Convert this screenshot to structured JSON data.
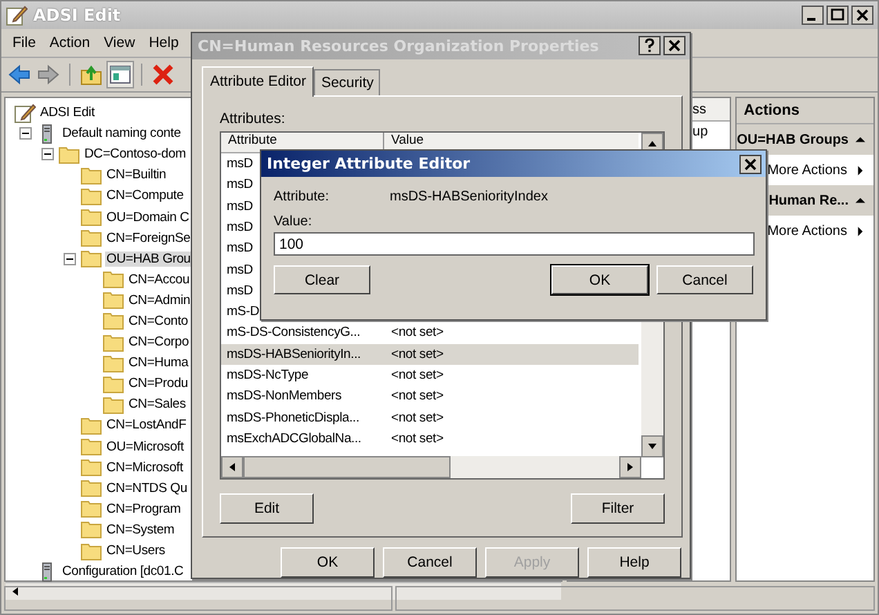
{
  "window": {
    "title": "ADSI Edit"
  },
  "menu": [
    "File",
    "Action",
    "View",
    "Help"
  ],
  "tree": [
    {
      "label": "ADSI Edit",
      "kind": "app",
      "selected": false,
      "children": [
        {
          "label": "Default naming conte",
          "kind": "server",
          "expanded": true,
          "selected": false,
          "children": [
            {
              "label": "DC=Contoso-dom",
              "kind": "folder",
              "expanded": true,
              "selected": false,
              "children": [
                {
                  "label": "CN=Builtin",
                  "kind": "folder",
                  "selected": false
                },
                {
                  "label": "CN=Compute",
                  "kind": "folder",
                  "selected": false
                },
                {
                  "label": "OU=Domain C",
                  "kind": "folder",
                  "selected": false
                },
                {
                  "label": "CN=ForeignSe",
                  "kind": "folder",
                  "selected": false
                },
                {
                  "label": "OU=HAB Grou",
                  "kind": "folder",
                  "expanded": true,
                  "selected": true,
                  "children": [
                    {
                      "label": "CN=Accou",
                      "kind": "folder",
                      "selected": false
                    },
                    {
                      "label": "CN=Admin",
                      "kind": "folder",
                      "selected": false
                    },
                    {
                      "label": "CN=Conto",
                      "kind": "folder",
                      "selected": false
                    },
                    {
                      "label": "CN=Corpo",
                      "kind": "folder",
                      "selected": false
                    },
                    {
                      "label": "CN=Huma",
                      "kind": "folder",
                      "selected": false
                    },
                    {
                      "label": "CN=Produ",
                      "kind": "folder",
                      "selected": false
                    },
                    {
                      "label": "CN=Sales",
                      "kind": "folder",
                      "selected": false
                    }
                  ]
                },
                {
                  "label": "CN=LostAndF",
                  "kind": "folder",
                  "selected": false
                },
                {
                  "label": "OU=Microsoft",
                  "kind": "folder",
                  "selected": false
                },
                {
                  "label": "CN=Microsoft",
                  "kind": "folder",
                  "selected": false
                },
                {
                  "label": "CN=NTDS Qu",
                  "kind": "folder",
                  "selected": false
                },
                {
                  "label": "CN=Program",
                  "kind": "folder",
                  "selected": false
                },
                {
                  "label": "CN=System",
                  "kind": "folder",
                  "selected": false
                },
                {
                  "label": "CN=Users",
                  "kind": "folder",
                  "selected": false
                }
              ]
            }
          ]
        },
        {
          "label": "Configuration [dc01.C",
          "kind": "server",
          "selected": false
        }
      ]
    }
  ],
  "list_panel": {
    "column_3": "ss",
    "rows": [
      "up"
    ]
  },
  "actions_panel": {
    "title": "Actions",
    "sections": [
      {
        "title": "OU=HAB Groups",
        "expanded": true,
        "items": [
          "More Actions"
        ]
      },
      {
        "title": "Human Re...",
        "expanded": true,
        "items": [
          "More Actions"
        ]
      }
    ]
  },
  "properties_dialog": {
    "title": "CN=Human Resources Organization Properties",
    "active": false,
    "tabs": [
      {
        "label": "Attribute Editor",
        "selected": true
      },
      {
        "label": "Security",
        "selected": false
      }
    ],
    "attributes_label": "Attributes:",
    "columns": [
      "Attribute",
      "Value"
    ],
    "rows": [
      {
        "attribute": "msD",
        "selected": false
      },
      {
        "attribute": "msD",
        "selected": false
      },
      {
        "attribute": "msD",
        "selected": false
      },
      {
        "attribute": "msD",
        "selected": false
      },
      {
        "attribute": "msD",
        "selected": false
      },
      {
        "attribute": "msD",
        "selected": false
      },
      {
        "attribute": "msD",
        "selected": false
      },
      {
        "attribute": "mS-D",
        "selected": false
      },
      {
        "attribute": "mS-DS-ConsistencyG...",
        "value": "<not set>",
        "selected": false
      },
      {
        "attribute": "msDS-HABSeniorityIn...",
        "value": "<not set>",
        "selected": true
      },
      {
        "attribute": "msDS-NcType",
        "value": "<not set>",
        "selected": false
      },
      {
        "attribute": "msDS-NonMembers",
        "value": "<not set>",
        "selected": false
      },
      {
        "attribute": "msDS-PhoneticDispla...",
        "value": "<not set>",
        "selected": false
      },
      {
        "attribute": "msExchADCGlobalNa...",
        "value": "<not set>",
        "selected": false
      }
    ],
    "list_buttons": [
      "Edit",
      "Filter"
    ],
    "footer_buttons": [
      {
        "label": "OK",
        "disabled": false
      },
      {
        "label": "Cancel",
        "disabled": false
      },
      {
        "label": "Apply",
        "disabled": true
      },
      {
        "label": "Help",
        "disabled": false
      }
    ]
  },
  "integer_editor": {
    "title": "Integer Attribute Editor",
    "active": true,
    "attribute_label": "Attribute:",
    "attribute_value": "msDS-HABSeniorityIndex",
    "value_label": "Value:",
    "value": "100",
    "buttons": [
      {
        "label": "Clear",
        "default": false
      },
      {
        "label": "OK",
        "default": true
      },
      {
        "label": "Cancel",
        "default": false
      }
    ]
  }
}
